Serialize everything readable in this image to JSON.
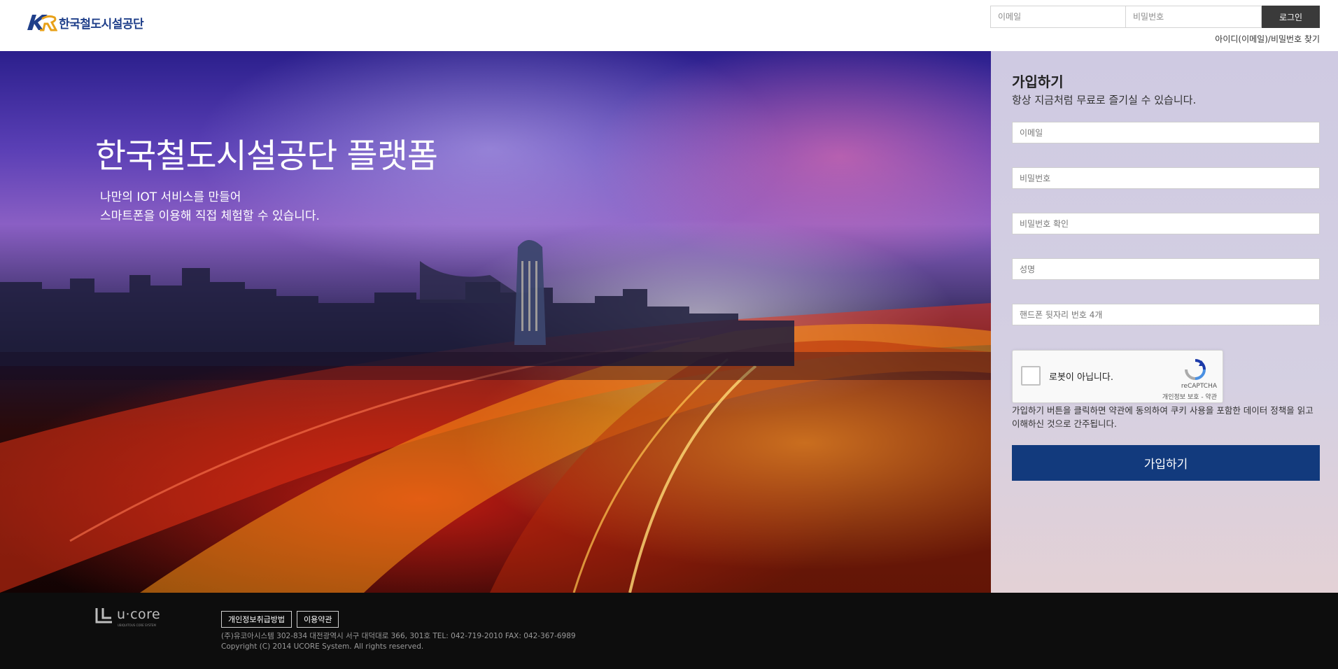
{
  "header": {
    "logo_text": "한국철도시설공단",
    "login": {
      "email_placeholder": "이메일",
      "password_placeholder": "비밀번호",
      "login_label": "로그인"
    },
    "find_account_label": "아이디(이메일)/비밀번호 찾기"
  },
  "hero": {
    "title": "한국철도시설공단 플랫폼",
    "subtitle_line1": "나만의 IOT 서비스를 만들어",
    "subtitle_line2": "스마트폰을 이용해 직접 체험할 수 있습니다."
  },
  "signup": {
    "title": "가입하기",
    "subtitle": "항상 지금처럼 무료로 즐기실 수 있습니다.",
    "fields": {
      "email": "이메일",
      "password": "비밀번호",
      "password_confirm": "비밀번호 확인",
      "name": "성명",
      "phone_last4": "핸드폰 뒷자리 번호 4개"
    },
    "captcha": {
      "label": "로봇이 아닙니다.",
      "brand": "reCAPTCHA",
      "links": "개인정보 보호 - 약관"
    },
    "terms_text": "가입하기 버튼을 클릭하면 약관에 동의하여 쿠키 사용을 포함한 데이터 정책을 읽고 이해하신 것으로 간주됩니다.",
    "submit_label": "가입하기"
  },
  "footer": {
    "company_logo_text": "u·core",
    "company_logo_tagline": "UBIQUITOUS CORE SYSTEM",
    "links": [
      "개인정보취급방법",
      "이용약관"
    ],
    "address": "(주)유코아시스템 302-834 대전광역시 서구 대덕대로 366, 301호 TEL: 042-719-2010 FAX: 042-367-6989",
    "copyright": "Copyright (C) 2014 UCORE System. All rights reserved."
  },
  "colors": {
    "brand_blue": "#123a7d",
    "login_button": "#3a3a3a",
    "footer_bg": "#0d0d0d"
  }
}
